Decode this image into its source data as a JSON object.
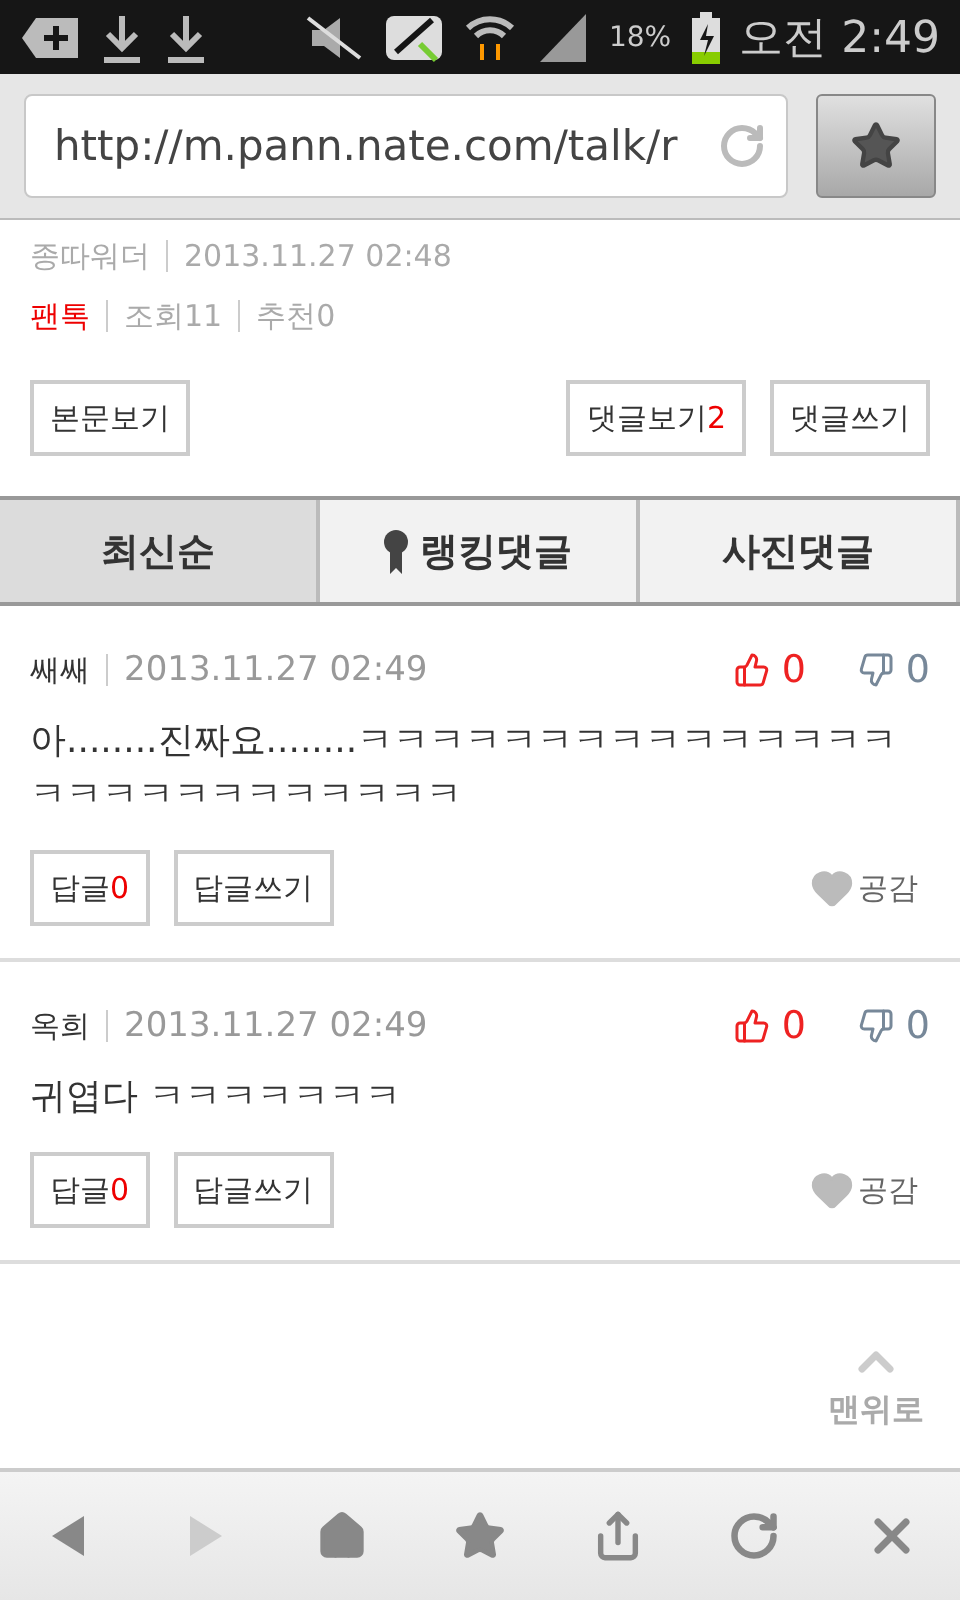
{
  "status_bar": {
    "battery": "18%",
    "time": "오전 2:49"
  },
  "address_bar": {
    "url": "http://m.pann.nate.com/talk/r"
  },
  "post": {
    "author": "종따워더",
    "date": "2013.11.27 02:48",
    "category": "팬톡",
    "views": "조회11",
    "recommends": "추천0"
  },
  "post_buttons": [
    {
      "label": "본문보기"
    },
    {
      "label": "댓글보기",
      "count": "2"
    },
    {
      "label": "댓글쓰기"
    }
  ],
  "tabs": [
    {
      "label": "최신순",
      "selected": true,
      "kind": "plain"
    },
    {
      "label": "랭킹댓글",
      "selected": false,
      "kind": "ranking"
    },
    {
      "label": "사진댓글",
      "selected": false,
      "kind": "plain"
    }
  ],
  "comments": [
    {
      "author": "쌔쌔",
      "date": "2013.11.27 02:49",
      "likes": "0",
      "dislikes": "0",
      "text": "아........진짜요........ㅋㅋㅋㅋㅋㅋㅋㅋㅋㅋㅋㅋㅋㅋㅋㅋㅋㅋㅋㅋㅋㅋㅋㅋㅋㅋㅋ",
      "reply_label": "답글",
      "reply_count": "0",
      "write_reply": "답글쓰기",
      "empathy": "공감"
    },
    {
      "author": "옥희",
      "date": "2013.11.27 02:49",
      "likes": "0",
      "dislikes": "0",
      "text": "귀엽다 ㅋㅋㅋㅋㅋㅋㅋ",
      "reply_label": "답글",
      "reply_count": "0",
      "write_reply": "답글쓰기",
      "empathy": "공감"
    }
  ],
  "scroll_top": {
    "label": "맨위로"
  },
  "bottom_nav": [
    {
      "kind": "back",
      "disabled": false
    },
    {
      "kind": "forward",
      "disabled": true
    },
    {
      "kind": "home",
      "disabled": false
    },
    {
      "kind": "bookmark",
      "disabled": false
    },
    {
      "kind": "share",
      "disabled": false
    },
    {
      "kind": "reload",
      "disabled": false
    },
    {
      "kind": "close",
      "disabled": false
    }
  ]
}
